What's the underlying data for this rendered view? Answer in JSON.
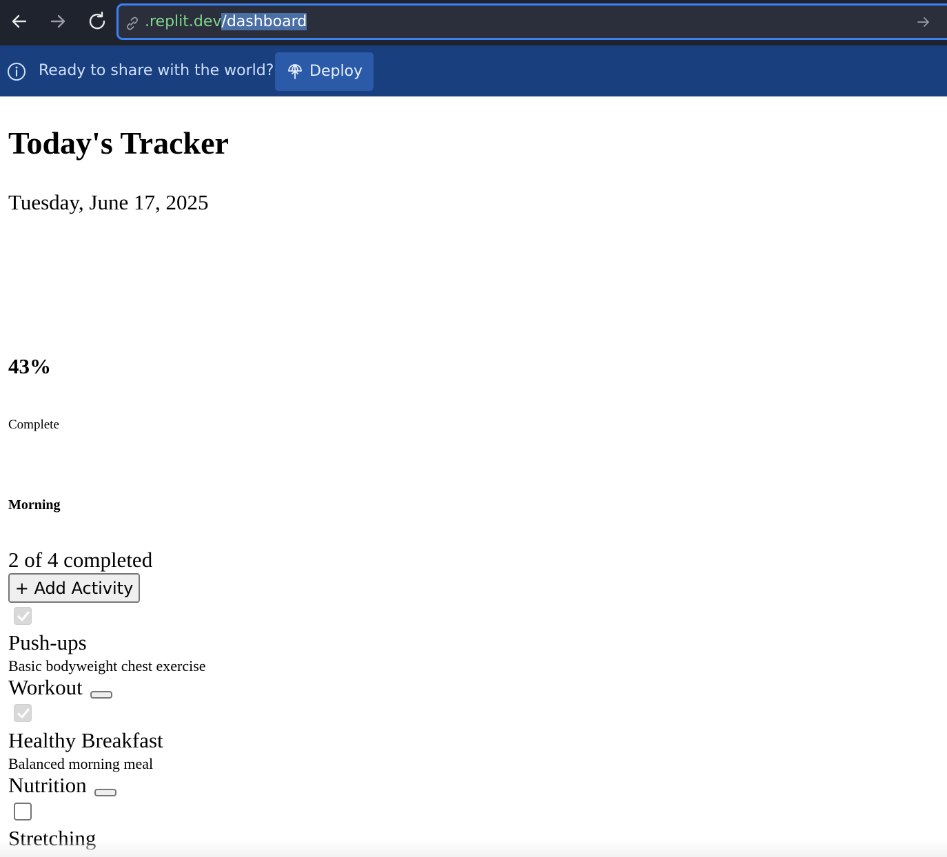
{
  "browser": {
    "url_host": ".replit.dev",
    "url_path": "/dashboard"
  },
  "banner": {
    "message": "Ready to share with the world?",
    "deploy_label": "Deploy"
  },
  "page": {
    "title": "Today's Tracker",
    "date": "Tuesday, June 17, 2025",
    "progress_percent_label": "43%",
    "progress_caption": "Complete"
  },
  "section": {
    "name": "Morning",
    "completed_summary": "2 of 4 completed",
    "add_button_label": "+ Add Activity",
    "activities": [
      {
        "title": "Push-ups",
        "description": "Basic bodyweight chest exercise",
        "category": "Workout",
        "checked": true
      },
      {
        "title": "Healthy Breakfast",
        "description": "Balanced morning meal",
        "category": "Nutrition",
        "checked": true
      },
      {
        "title": "Stretching",
        "checked": false
      }
    ]
  },
  "colors": {
    "toolbar_bg": "#1f232d",
    "url_focus_border": "#3b82f6",
    "url_host": "#7ed68a",
    "banner_bg": "#1a3f7e",
    "deploy_button_bg": "#2b5aa8"
  }
}
